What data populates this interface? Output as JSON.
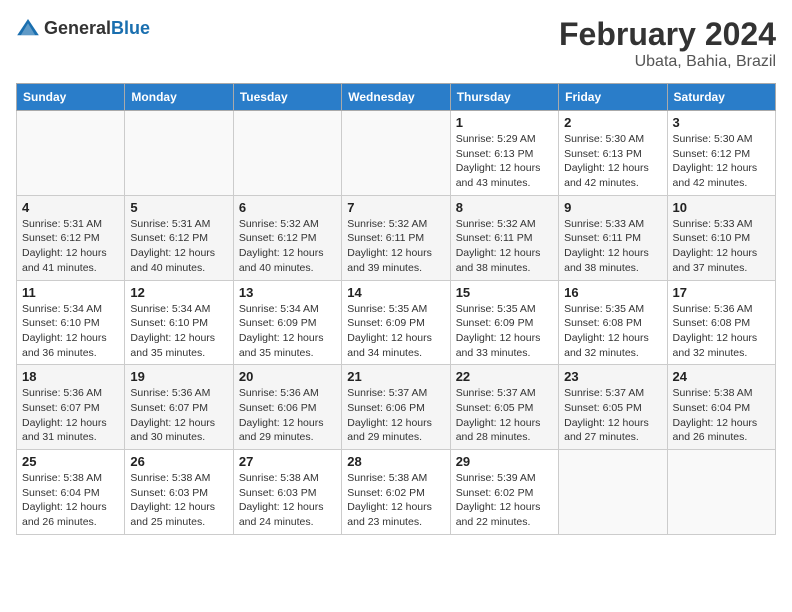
{
  "header": {
    "logo_general": "General",
    "logo_blue": "Blue",
    "month": "February 2024",
    "location": "Ubata, Bahia, Brazil"
  },
  "weekdays": [
    "Sunday",
    "Monday",
    "Tuesday",
    "Wednesday",
    "Thursday",
    "Friday",
    "Saturday"
  ],
  "weeks": [
    [
      {
        "day": "",
        "info": ""
      },
      {
        "day": "",
        "info": ""
      },
      {
        "day": "",
        "info": ""
      },
      {
        "day": "",
        "info": ""
      },
      {
        "day": "1",
        "info": "Sunrise: 5:29 AM\nSunset: 6:13 PM\nDaylight: 12 hours\nand 43 minutes."
      },
      {
        "day": "2",
        "info": "Sunrise: 5:30 AM\nSunset: 6:13 PM\nDaylight: 12 hours\nand 42 minutes."
      },
      {
        "day": "3",
        "info": "Sunrise: 5:30 AM\nSunset: 6:12 PM\nDaylight: 12 hours\nand 42 minutes."
      }
    ],
    [
      {
        "day": "4",
        "info": "Sunrise: 5:31 AM\nSunset: 6:12 PM\nDaylight: 12 hours\nand 41 minutes."
      },
      {
        "day": "5",
        "info": "Sunrise: 5:31 AM\nSunset: 6:12 PM\nDaylight: 12 hours\nand 40 minutes."
      },
      {
        "day": "6",
        "info": "Sunrise: 5:32 AM\nSunset: 6:12 PM\nDaylight: 12 hours\nand 40 minutes."
      },
      {
        "day": "7",
        "info": "Sunrise: 5:32 AM\nSunset: 6:11 PM\nDaylight: 12 hours\nand 39 minutes."
      },
      {
        "day": "8",
        "info": "Sunrise: 5:32 AM\nSunset: 6:11 PM\nDaylight: 12 hours\nand 38 minutes."
      },
      {
        "day": "9",
        "info": "Sunrise: 5:33 AM\nSunset: 6:11 PM\nDaylight: 12 hours\nand 38 minutes."
      },
      {
        "day": "10",
        "info": "Sunrise: 5:33 AM\nSunset: 6:10 PM\nDaylight: 12 hours\nand 37 minutes."
      }
    ],
    [
      {
        "day": "11",
        "info": "Sunrise: 5:34 AM\nSunset: 6:10 PM\nDaylight: 12 hours\nand 36 minutes."
      },
      {
        "day": "12",
        "info": "Sunrise: 5:34 AM\nSunset: 6:10 PM\nDaylight: 12 hours\nand 35 minutes."
      },
      {
        "day": "13",
        "info": "Sunrise: 5:34 AM\nSunset: 6:09 PM\nDaylight: 12 hours\nand 35 minutes."
      },
      {
        "day": "14",
        "info": "Sunrise: 5:35 AM\nSunset: 6:09 PM\nDaylight: 12 hours\nand 34 minutes."
      },
      {
        "day": "15",
        "info": "Sunrise: 5:35 AM\nSunset: 6:09 PM\nDaylight: 12 hours\nand 33 minutes."
      },
      {
        "day": "16",
        "info": "Sunrise: 5:35 AM\nSunset: 6:08 PM\nDaylight: 12 hours\nand 32 minutes."
      },
      {
        "day": "17",
        "info": "Sunrise: 5:36 AM\nSunset: 6:08 PM\nDaylight: 12 hours\nand 32 minutes."
      }
    ],
    [
      {
        "day": "18",
        "info": "Sunrise: 5:36 AM\nSunset: 6:07 PM\nDaylight: 12 hours\nand 31 minutes."
      },
      {
        "day": "19",
        "info": "Sunrise: 5:36 AM\nSunset: 6:07 PM\nDaylight: 12 hours\nand 30 minutes."
      },
      {
        "day": "20",
        "info": "Sunrise: 5:36 AM\nSunset: 6:06 PM\nDaylight: 12 hours\nand 29 minutes."
      },
      {
        "day": "21",
        "info": "Sunrise: 5:37 AM\nSunset: 6:06 PM\nDaylight: 12 hours\nand 29 minutes."
      },
      {
        "day": "22",
        "info": "Sunrise: 5:37 AM\nSunset: 6:05 PM\nDaylight: 12 hours\nand 28 minutes."
      },
      {
        "day": "23",
        "info": "Sunrise: 5:37 AM\nSunset: 6:05 PM\nDaylight: 12 hours\nand 27 minutes."
      },
      {
        "day": "24",
        "info": "Sunrise: 5:38 AM\nSunset: 6:04 PM\nDaylight: 12 hours\nand 26 minutes."
      }
    ],
    [
      {
        "day": "25",
        "info": "Sunrise: 5:38 AM\nSunset: 6:04 PM\nDaylight: 12 hours\nand 26 minutes."
      },
      {
        "day": "26",
        "info": "Sunrise: 5:38 AM\nSunset: 6:03 PM\nDaylight: 12 hours\nand 25 minutes."
      },
      {
        "day": "27",
        "info": "Sunrise: 5:38 AM\nSunset: 6:03 PM\nDaylight: 12 hours\nand 24 minutes."
      },
      {
        "day": "28",
        "info": "Sunrise: 5:38 AM\nSunset: 6:02 PM\nDaylight: 12 hours\nand 23 minutes."
      },
      {
        "day": "29",
        "info": "Sunrise: 5:39 AM\nSunset: 6:02 PM\nDaylight: 12 hours\nand 22 minutes."
      },
      {
        "day": "",
        "info": ""
      },
      {
        "day": "",
        "info": ""
      }
    ]
  ]
}
